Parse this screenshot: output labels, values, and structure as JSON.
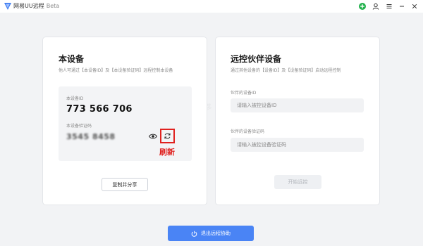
{
  "titlebar": {
    "app_title": "网易UU远程",
    "beta": "Beta"
  },
  "local_device": {
    "title": "本设备",
    "subtitle": "他人可通过【本设备ID】及【本设备验证码】远程控制本设备",
    "id_label": "本设备ID",
    "id_value": "773 566 706",
    "code_label": "本设备验证码",
    "code_value": "3545 8458",
    "refresh_annotation": "刷新",
    "copy_share_label": "复制并分享"
  },
  "partner_device": {
    "title": "远控伙伴设备",
    "subtitle": "通过其他设备的【设备ID】及【设备验证码】启动远程控制",
    "id_label": "伙伴的设备ID",
    "id_placeholder": "请输入被控设备ID",
    "code_label": "伙伴的设备验证码",
    "code_placeholder": "请输入被控设备验证码",
    "start_label": "开始远控"
  },
  "exit_button_label": "退出远程协助",
  "watermark": "系统天堂",
  "colors": {
    "accent": "#4a84f5",
    "annotation_red": "#e0211f",
    "status_green": "#22b14c"
  },
  "icons": {
    "logo": "uu-logo-icon",
    "status": "plus-circle-icon",
    "user": "user-icon",
    "menu": "menu-icon",
    "minimize": "minimize-icon",
    "close": "close-icon",
    "eye": "eye-icon",
    "refresh": "refresh-icon",
    "power": "power-icon"
  }
}
